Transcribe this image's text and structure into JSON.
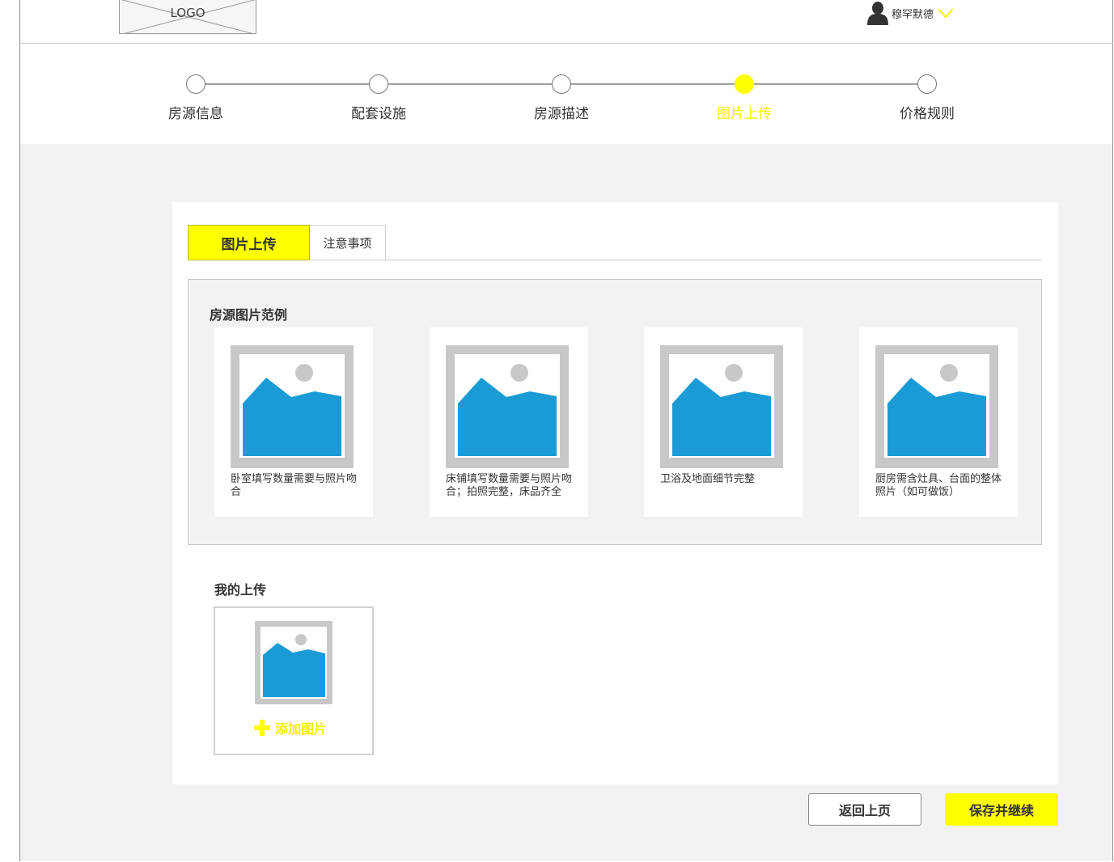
{
  "header": {
    "logo_text": "LOGO",
    "user_name": "穆罕默德",
    "user_icon": "user-avatar-icon",
    "caret_icon": "chevron-down-icon"
  },
  "steps": [
    {
      "label": "房源信息",
      "active": false
    },
    {
      "label": "配套设施",
      "active": false
    },
    {
      "label": "房源描述",
      "active": false
    },
    {
      "label": "图片上传",
      "active": true
    },
    {
      "label": "价格规则",
      "active": false
    }
  ],
  "tabs": {
    "upload": "图片上传",
    "notes": "注意事项"
  },
  "samples": {
    "title": "房源图片范例",
    "items": [
      {
        "caption": "卧室填写数量需要与照片吻合"
      },
      {
        "caption": "床铺填写数量需要与照片吻合；拍照完整，床品齐全"
      },
      {
        "caption": "卫浴及地面细节完整"
      },
      {
        "caption": "厨房需含灶具、台面的整体照片（如可做饭）"
      }
    ]
  },
  "my_upload": {
    "title": "我的上传",
    "add_label": "添加图片",
    "add_icon": "plus-icon"
  },
  "actions": {
    "back_label": "返回上页",
    "save_label": "保存并继续"
  },
  "colors": {
    "accent": "#ffff00",
    "image_blue": "#1a9bd6",
    "image_frame": "#c8c8c8"
  }
}
